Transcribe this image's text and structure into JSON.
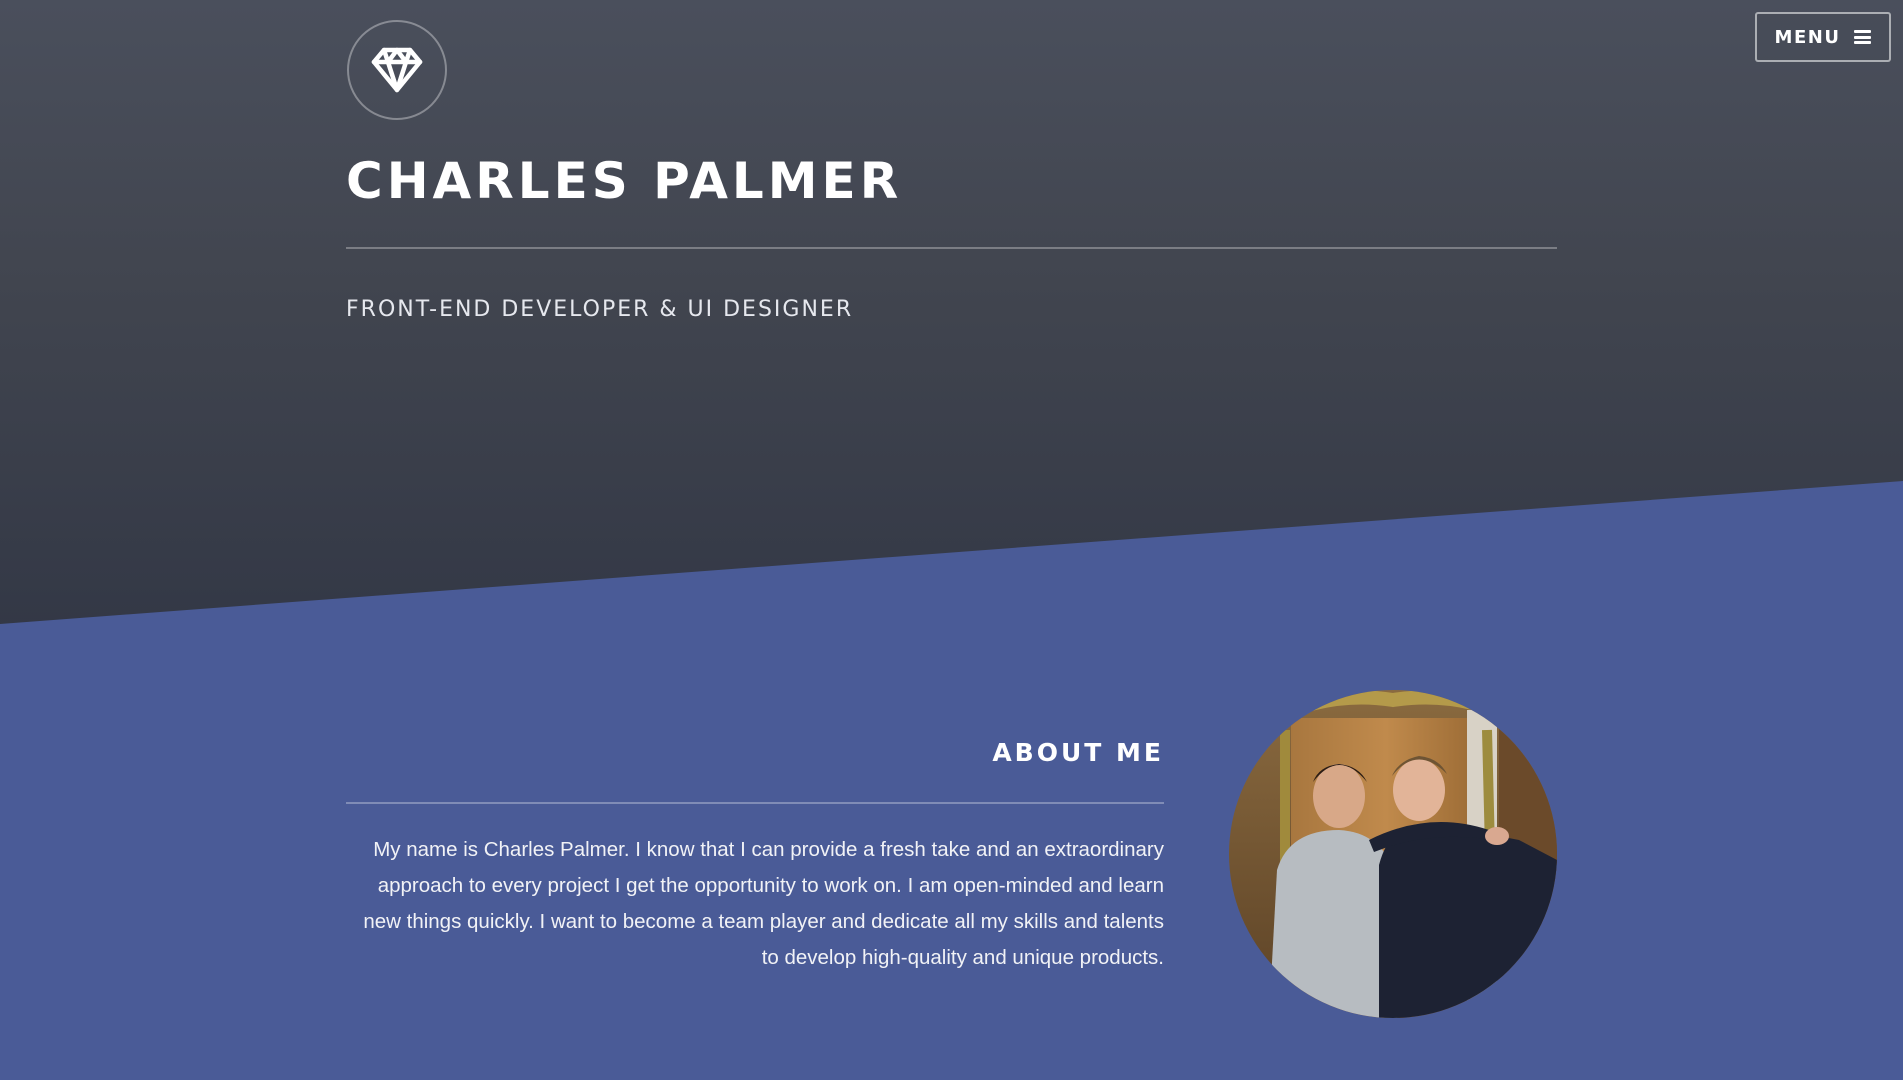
{
  "header": {
    "menu_label": "MENU",
    "logo_icon": "diamond-icon",
    "menu_icon": "hamburger-icon"
  },
  "hero": {
    "name": "CHARLES PALMER",
    "tagline": "FRONT-END DEVELOPER & UI DESIGNER"
  },
  "about": {
    "heading": "ABOUT ME",
    "text": "My name is Charles Palmer. I know that I can provide a fresh take and an extraordinary approach to every project I get the opportunity to work on. I am open-minded and learn new things quickly. I want to become a team player and dedicate all my skills and talents to develop high-quality and unique products.",
    "photo": "profile-photo"
  },
  "colors": {
    "hero_bg": "#44485a",
    "about_bg": "#4a5b97",
    "text": "#ffffff"
  }
}
